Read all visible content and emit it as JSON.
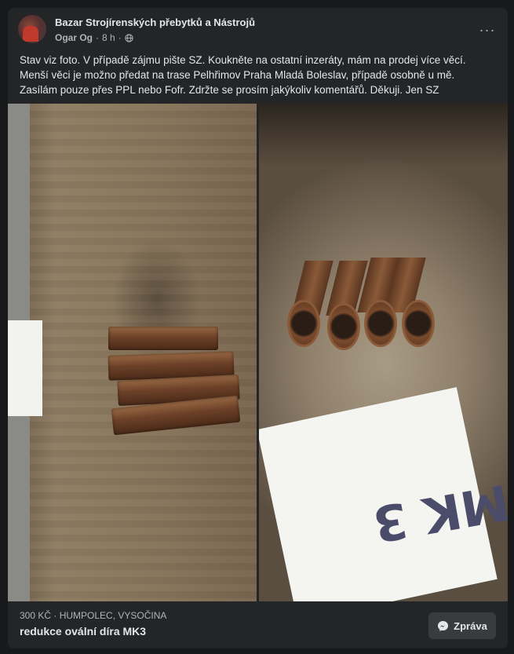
{
  "post": {
    "group_name": "Bazar Strojírenských přebytků a Nástrojů",
    "author": "Ogar Og",
    "separator": "·",
    "time": "8 h",
    "separator2": "·",
    "more_label": "···",
    "text_lines": [
      "Stav viz foto. V případě zájmu pište SZ. Koukněte na ostatní inzeráty, mám na prodej více věcí.",
      "Menší věci je možno předat na trase Pelhřimov Praha Mladá Boleslav, případě osobně u mě.",
      "Zasílám pouze přes PPL nebo Fofr. Zdržte se prosím jakýkoliv komentářů. Děkuji. Jen SZ"
    ]
  },
  "photos": {
    "right_label": "MK 3"
  },
  "listing": {
    "price_location": "300 KČ · HUMPOLEC, VYSOČINA",
    "title": "redukce ovální díra MK3",
    "message_button": "Zpráva"
  },
  "icons": {
    "privacy": "globe-icon",
    "messenger": "messenger-icon",
    "more": "more-icon"
  },
  "colors": {
    "background": "#18191a",
    "card": "#242526",
    "button": "#3a3b3c",
    "text_primary": "#e4e6eb",
    "text_secondary": "#b0b3b8"
  }
}
